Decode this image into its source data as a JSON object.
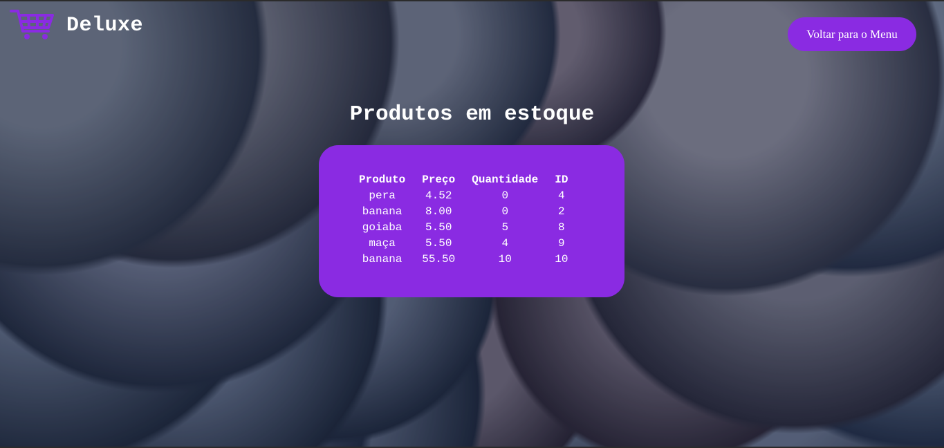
{
  "header": {
    "brand": "Deluxe",
    "logo_icon": "shopping-cart-icon",
    "menu_button_label": "Voltar para o Menu"
  },
  "main": {
    "title": "Produtos em estoque",
    "table": {
      "columns": [
        "Produto",
        "Preço",
        "Quantidade",
        "ID"
      ],
      "rows": [
        [
          "pera",
          "4.52",
          "0",
          "4"
        ],
        [
          "banana",
          "8.00",
          "0",
          "2"
        ],
        [
          "goiaba",
          "5.50",
          "5",
          "8"
        ],
        [
          "maça",
          "5.50",
          "4",
          "9"
        ],
        [
          "banana",
          "55.50",
          "10",
          "10"
        ]
      ]
    }
  },
  "colors": {
    "accent": "#8a2be2",
    "text": "#ffffff"
  }
}
